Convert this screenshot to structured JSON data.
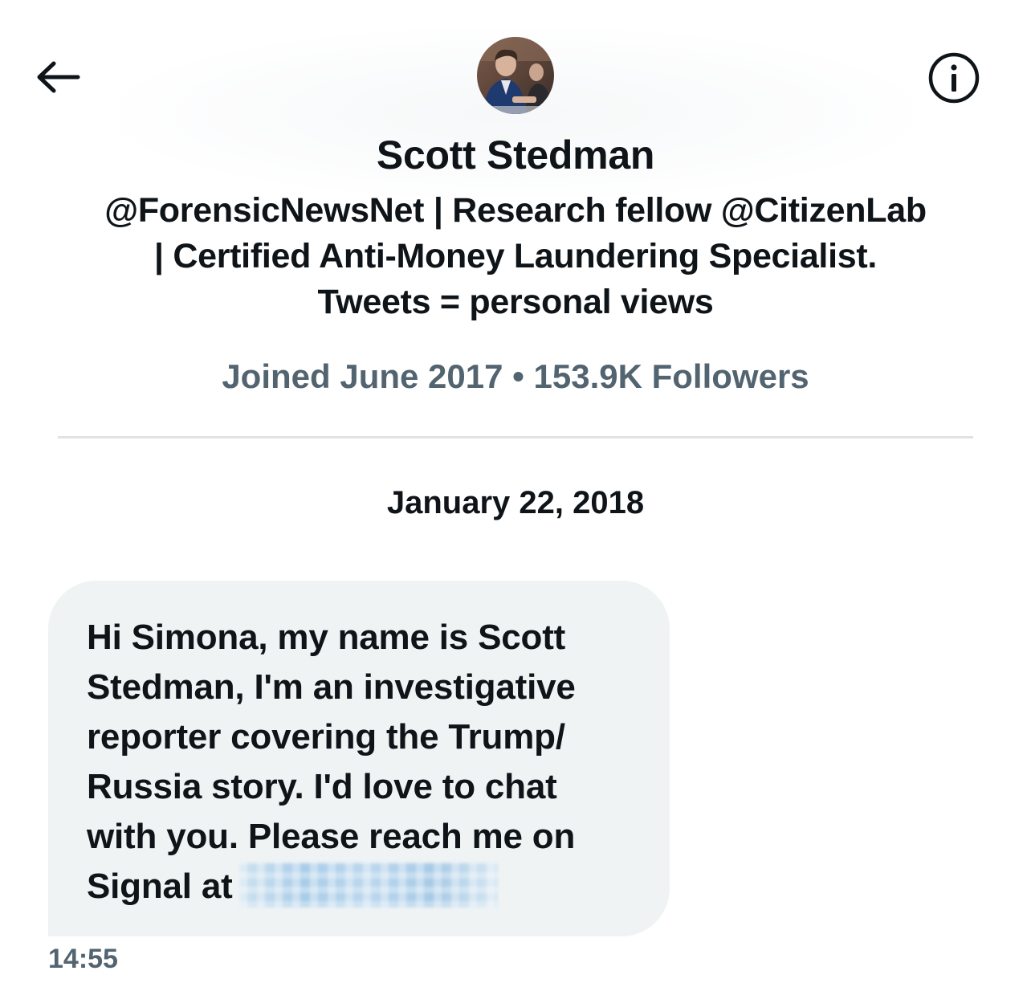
{
  "header": {
    "back_icon": "arrow-left-icon",
    "info_icon": "info-circle-icon"
  },
  "profile": {
    "name": "Scott Stedman",
    "bio_lines": [
      "@ForensicNewsNet | Research fellow @CitizenLab",
      "| Certified Anti-Money Laundering Specialist.",
      "Tweets = personal views"
    ],
    "meta": "Joined June 2017 • 153.9K Followers"
  },
  "conversation": {
    "date": "January 22, 2018",
    "message": {
      "lines": [
        "Hi Simona, my name is Scott",
        "Stedman, I'm an investigative",
        "reporter covering the Trump/",
        "Russia story. I'd love to chat",
        "with you. Please reach me on",
        "Signal at"
      ],
      "time": "14:55"
    }
  },
  "colors": {
    "text_primary": "#0f1419",
    "text_secondary": "#536471",
    "bubble_bg": "#eff3f4",
    "divider": "#dfe3e6"
  }
}
